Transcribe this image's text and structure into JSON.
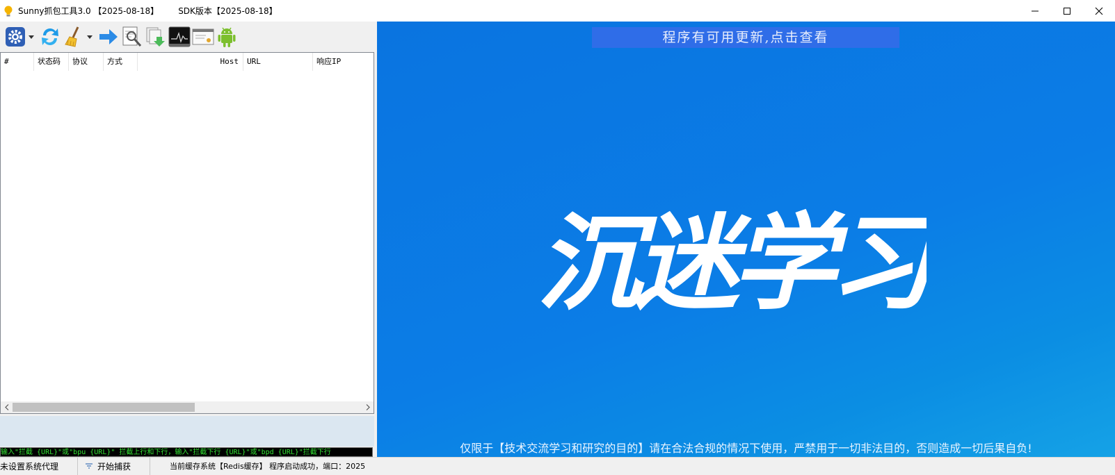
{
  "window": {
    "title": "Sunny抓包工具3.0 【2025-08-18】",
    "sdk_version": "SDK版本【2025-08-18】"
  },
  "toolbar": {
    "buttons": [
      {
        "icon": "settings-gear-icon"
      },
      {
        "icon": "refresh-icon"
      },
      {
        "icon": "broom-clear-icon"
      },
      {
        "icon": "forward-arrow-icon"
      },
      {
        "icon": "search-document-icon"
      },
      {
        "icon": "export-documents-icon"
      },
      {
        "icon": "monitor-waveform-icon"
      },
      {
        "icon": "certificate-icon"
      },
      {
        "icon": "android-icon"
      }
    ]
  },
  "grid": {
    "columns": [
      "#",
      "状态码",
      "协议",
      "方式",
      "Host",
      "URL",
      "响应IP"
    ],
    "rows": []
  },
  "console": {
    "text": "输入\"拦截 {URL}\"或\"bpu {URL}\" 拦截上行和下行，输入\"拦截下行 {URL}\"或\"bpd {URL}\"拦截下行"
  },
  "banner": {
    "update_notice": "程序有可用更新,点击查看",
    "slogan": "沉迷学习",
    "disclaimer": "仅限于【技术交流学习和研究的目的】请在合法合规的情况下使用，严禁用于一切非法目的，否则造成一切后果自负!",
    "colors": {
      "background": "#0a7ae2",
      "update_bar": "#2f6de8"
    }
  },
  "statusbar": {
    "proxy_status": "未设置系统代理",
    "capture_label": "开始捕获",
    "cache_status": "当前缓存系统【Redis缓存】 程序启动成功，端口：2025"
  }
}
